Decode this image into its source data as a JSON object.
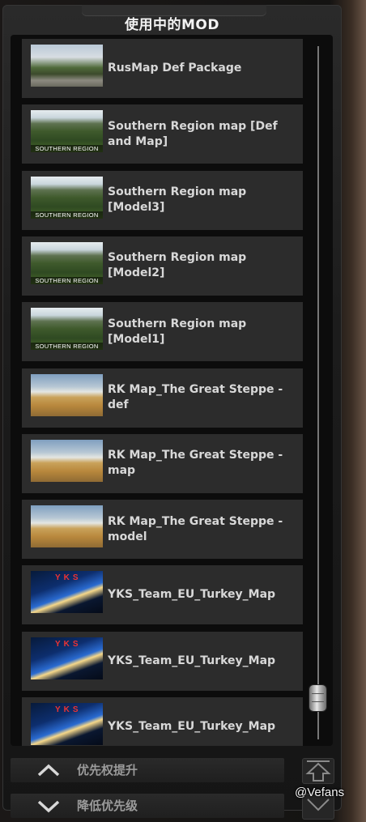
{
  "panel": {
    "title": "使用中的MOD"
  },
  "mods": [
    {
      "name": "RusMap Def Package",
      "thumb": "village",
      "thumb_text": ""
    },
    {
      "name": "Southern Region map [Def and Map]",
      "thumb": "hills",
      "thumb_text": "SOUTHERN REGION"
    },
    {
      "name": "Southern Region map [Model3]",
      "thumb": "hills",
      "thumb_text": "SOUTHERN REGION"
    },
    {
      "name": "Southern Region map [Model2]",
      "thumb": "hills",
      "thumb_text": "SOUTHERN REGION"
    },
    {
      "name": "Southern Region map [Model1]",
      "thumb": "hills",
      "thumb_text": "SOUTHERN REGION"
    },
    {
      "name": "RK Map_The Great Steppe - def",
      "thumb": "steppe",
      "thumb_text": ""
    },
    {
      "name": "RK Map_The Great Steppe - map",
      "thumb": "steppe",
      "thumb_text": ""
    },
    {
      "name": "RK Map_The Great Steppe - model",
      "thumb": "steppe",
      "thumb_text": ""
    },
    {
      "name": "YKS_Team_EU_Turkey_Map",
      "thumb": "yks",
      "thumb_text": "YKS"
    },
    {
      "name": "YKS_Team_EU_Turkey_Map",
      "thumb": "yks",
      "thumb_text": "YKS"
    },
    {
      "name": "YKS_Team_EU_Turkey_Map",
      "thumb": "yks",
      "thumb_text": "YKS"
    }
  ],
  "buttons": {
    "priority_up": "优先权提升",
    "priority_down": "降低优先级"
  },
  "watermark": "@Vefans"
}
